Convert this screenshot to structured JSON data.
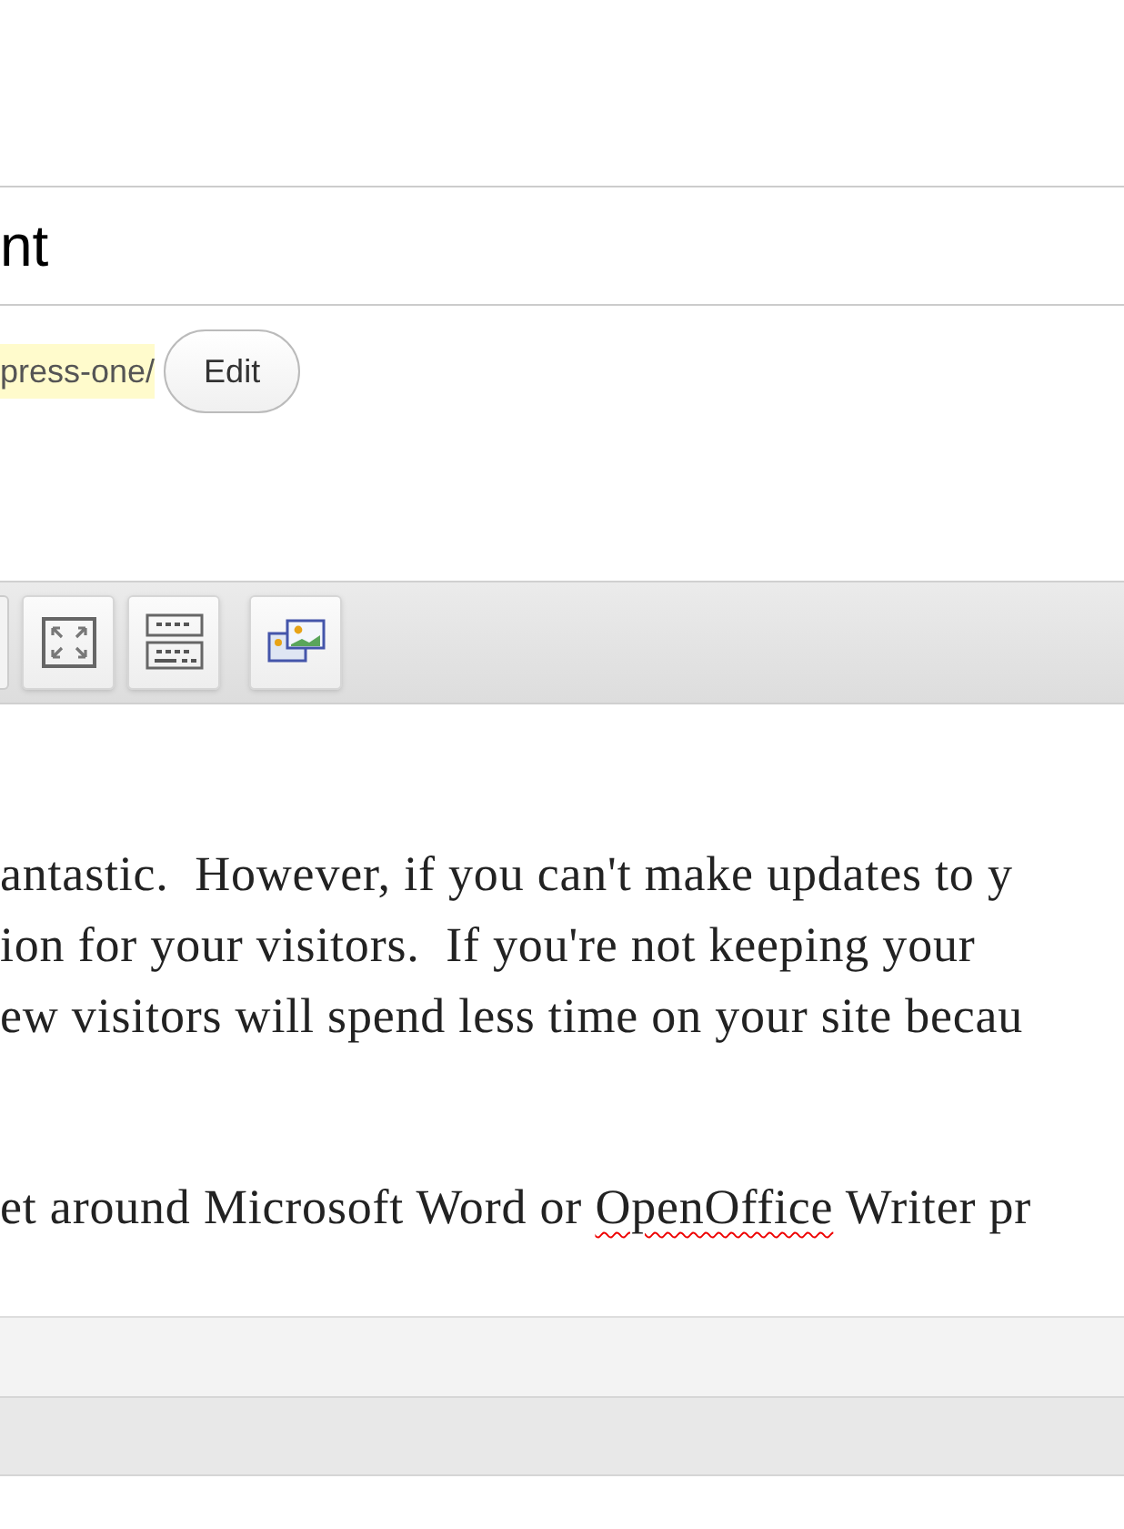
{
  "title_field": {
    "value": "nt"
  },
  "permalink": {
    "slug": "press-one/",
    "edit_button": "Edit"
  },
  "toolbar": {
    "buttons": [
      {
        "kind": "partial"
      },
      {
        "kind": "fullscreen"
      },
      {
        "kind": "kitchen-sink"
      },
      {
        "kind": "media"
      }
    ]
  },
  "content": {
    "paragraphs": [
      {
        "lines": [
          "antastic.  However, if you can't make updates to y",
          "ion for your visitors.  If you're not keeping your",
          "ew visitors will spend less time on your site becau"
        ]
      },
      {
        "lines": [
          [
            {
              "text": "et around Microsoft Word or ",
              "misspelled": false
            },
            {
              "text": "OpenOffice",
              "misspelled": true
            },
            {
              "text": " Writer pr",
              "misspelled": false
            }
          ]
        ]
      }
    ]
  }
}
